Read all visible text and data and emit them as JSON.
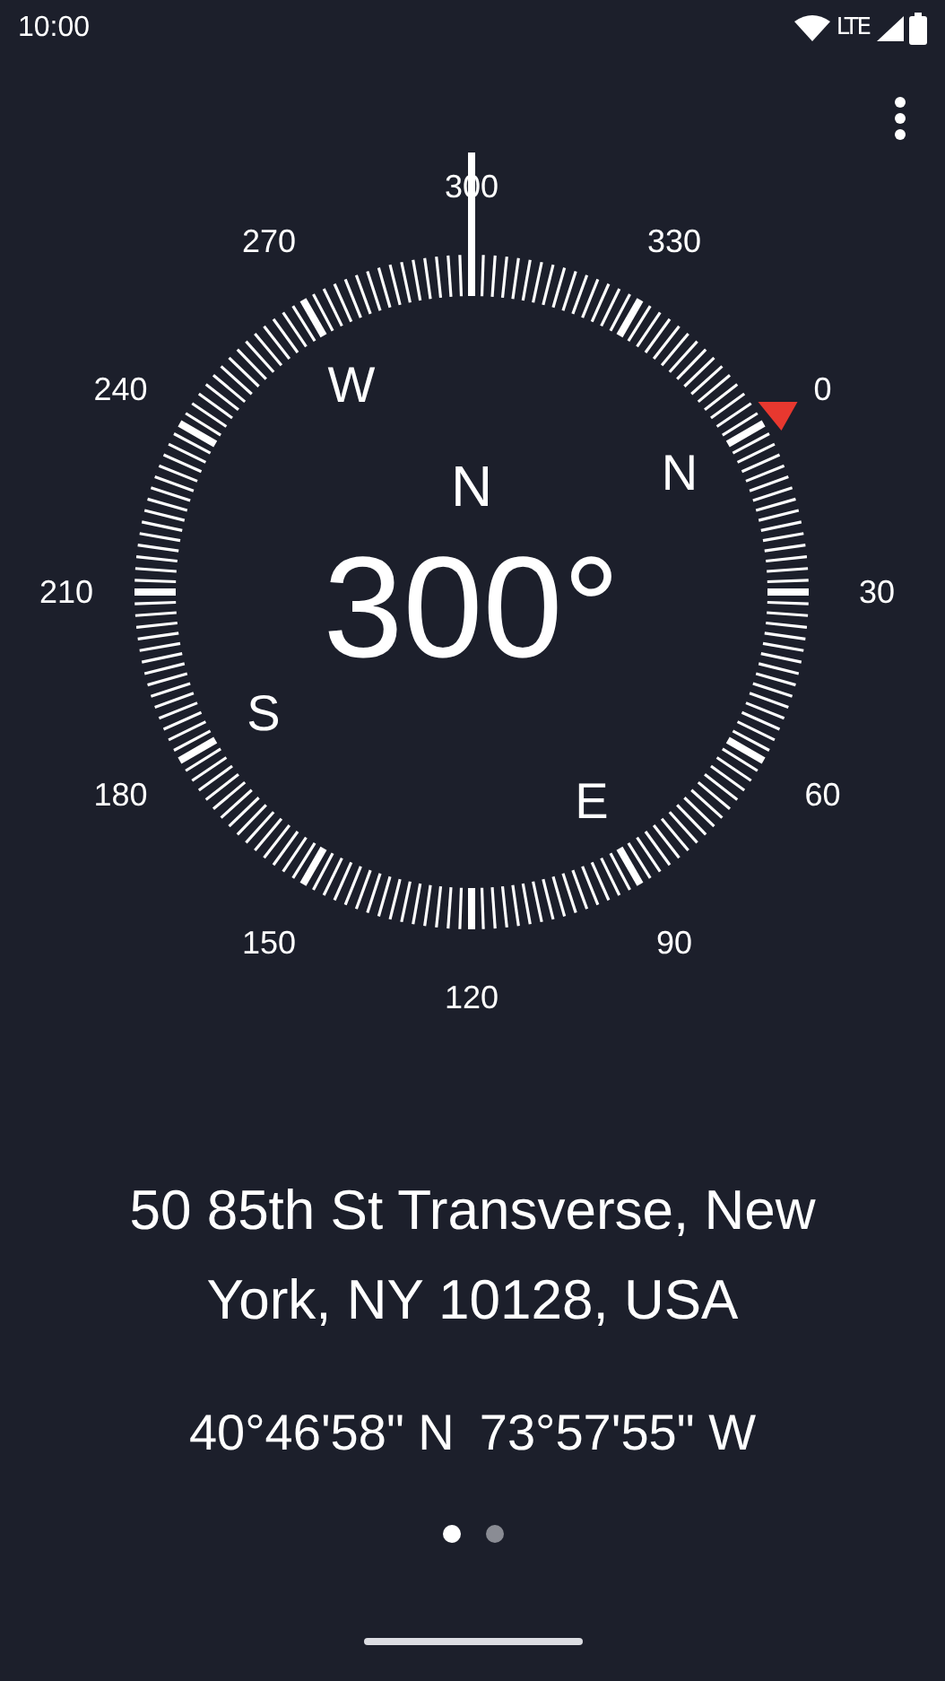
{
  "status_bar": {
    "time": "10:00",
    "network": "LTE"
  },
  "dial": {
    "degree_labels": [
      "300",
      "330",
      "0",
      "30",
      "60",
      "90",
      "120",
      "150",
      "180",
      "210",
      "240",
      "270"
    ],
    "cardinals": [
      "W",
      "N",
      "E",
      "S"
    ]
  },
  "direction": "N",
  "heading": "300°",
  "address": "50 85th St Transverse, New York, NY 10128, USA",
  "coordinates": [
    "40°46'58\" N",
    "73°57'55\" W"
  ],
  "pages": [
    {
      "selected": true
    },
    {
      "selected": false
    }
  ]
}
